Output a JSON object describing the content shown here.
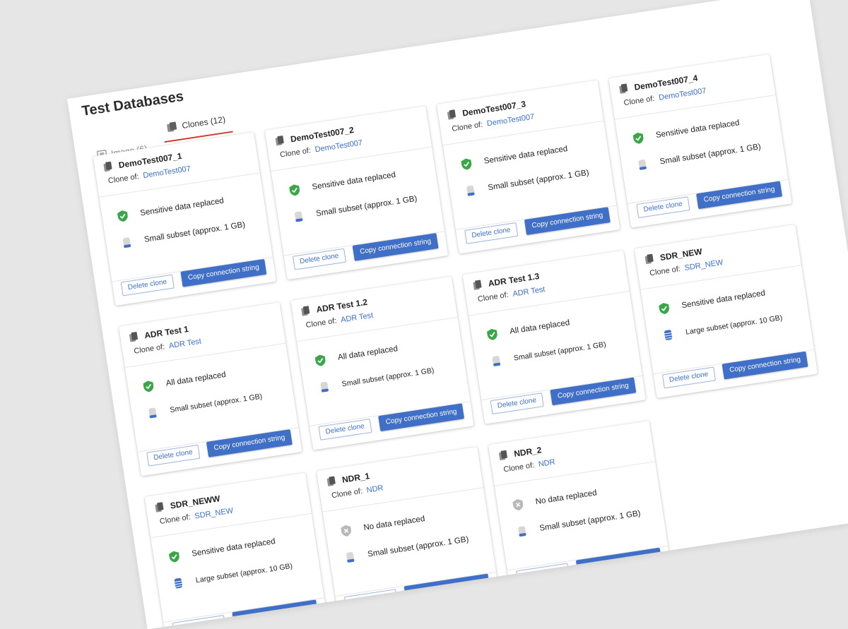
{
  "page": {
    "title": "Test Databases",
    "tabs": [
      {
        "label": "Image (6)",
        "active": false
      },
      {
        "label": "Clones (12)",
        "active": true
      }
    ]
  },
  "labels": {
    "clone_of": "Clone of:",
    "delete": "Delete clone",
    "copy": "Copy connection string"
  },
  "colors": {
    "accent": "#3f6fc6",
    "tab_underline": "#d23b2f",
    "ok_green": "#3aa64a"
  },
  "cards": [
    {
      "name": "DemoTest007_1",
      "source": "DemoTest007",
      "data_status": "Sensitive data replaced",
      "status_icon": "check-shield-icon",
      "subset": "Small subset (approx. 1 GB)",
      "subset_small_text": false,
      "subset_icon": "small-database-icon"
    },
    {
      "name": "DemoTest007_2",
      "source": "DemoTest007",
      "data_status": "Sensitive data replaced",
      "status_icon": "check-shield-icon",
      "subset": "Small subset (approx. 1 GB)",
      "subset_small_text": false,
      "subset_icon": "small-database-icon"
    },
    {
      "name": "DemoTest007_3",
      "source": "DemoTest007",
      "data_status": "Sensitive data replaced",
      "status_icon": "check-shield-icon",
      "subset": "Small subset (approx. 1 GB)",
      "subset_small_text": false,
      "subset_icon": "small-database-icon"
    },
    {
      "name": "DemoTest007_4",
      "source": "DemoTest007",
      "data_status": "Sensitive data replaced",
      "status_icon": "check-shield-icon",
      "subset": "Small subset (approx. 1 GB)",
      "subset_small_text": false,
      "subset_icon": "small-database-icon"
    },
    {
      "name": "ADR Test 1",
      "source": "ADR Test",
      "data_status": "All data replaced",
      "status_icon": "check-shield-icon",
      "subset": "Small subset (approx. 1 GB)",
      "subset_small_text": true,
      "subset_icon": "small-database-icon"
    },
    {
      "name": "ADR Test 1.2",
      "source": "ADR Test",
      "data_status": "All data replaced",
      "status_icon": "check-shield-icon",
      "subset": "Small subset (approx. 1 GB)",
      "subset_small_text": true,
      "subset_icon": "small-database-icon"
    },
    {
      "name": "ADR Test 1.3",
      "source": "ADR Test",
      "data_status": "All data replaced",
      "status_icon": "check-shield-icon",
      "subset": "Small subset (approx. 1 GB)",
      "subset_small_text": true,
      "subset_icon": "small-database-icon"
    },
    {
      "name": "SDR_NEW",
      "source": "SDR_NEW",
      "data_status": "Sensitive data replaced",
      "status_icon": "check-shield-icon",
      "subset": "Large subset (approx. 10 GB)",
      "subset_small_text": true,
      "subset_icon": "large-database-icon"
    },
    {
      "name": "SDR_NEWW",
      "source": "SDR_NEW",
      "data_status": "Sensitive data replaced",
      "status_icon": "check-shield-icon",
      "subset": "Large subset (approx. 10 GB)",
      "subset_small_text": true,
      "subset_icon": "large-database-icon"
    },
    {
      "name": "NDR_1",
      "source": "NDR",
      "data_status": "No data replaced",
      "status_icon": "x-shield-icon",
      "subset": "Small subset (approx. 1 GB)",
      "subset_small_text": false,
      "subset_icon": "small-database-icon"
    },
    {
      "name": "NDR_2",
      "source": "NDR",
      "data_status": "No data replaced",
      "status_icon": "x-shield-icon",
      "subset": "Small subset (approx. 1 GB)",
      "subset_small_text": false,
      "subset_icon": "small-database-icon"
    }
  ]
}
